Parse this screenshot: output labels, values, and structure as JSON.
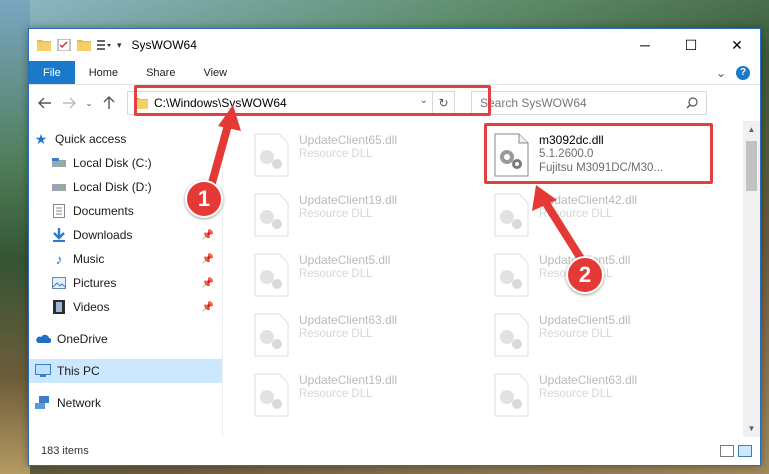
{
  "window": {
    "title": "SysWOW64",
    "controls": {
      "minimize": "─",
      "maximize": "☐",
      "close": "✕"
    }
  },
  "ribbon": {
    "tabs": [
      "File",
      "Home",
      "Share",
      "View"
    ],
    "expand": "⌄",
    "help": "?"
  },
  "address_bar": {
    "path": "C:\\Windows\\SysWOW64",
    "refresh": "↻",
    "dropdown": "⌄"
  },
  "search": {
    "placeholder": "Search SysWOW64"
  },
  "nav_pane": {
    "quick_access": "Quick access",
    "items": [
      {
        "label": "Local Disk (C:)",
        "icon": "drive-icon",
        "pinned": false
      },
      {
        "label": "Local Disk (D:)",
        "icon": "drive-icon",
        "pinned": false
      },
      {
        "label": "Documents",
        "icon": "documents-icon",
        "pinned": false
      },
      {
        "label": "Downloads",
        "icon": "downloads-icon",
        "pinned": true
      },
      {
        "label": "Music",
        "icon": "music-icon",
        "pinned": true
      },
      {
        "label": "Pictures",
        "icon": "pictures-icon",
        "pinned": true
      },
      {
        "label": "Videos",
        "icon": "videos-icon",
        "pinned": true
      }
    ],
    "onedrive": "OneDrive",
    "this_pc": "This PC",
    "network": "Network"
  },
  "files": {
    "left_column": [
      {
        "name": "UpdateClient65.dll",
        "type": "Resource DLL"
      },
      {
        "name": "UpdateClient19.dll",
        "type": "Resource DLL"
      },
      {
        "name": "UpdateClient5.dll",
        "type": "Resource DLL"
      },
      {
        "name": "UpdateClient63.dll",
        "type": "Resource DLL"
      },
      {
        "name": "UpdateClient19.dll",
        "type": "Resource DLL"
      }
    ],
    "right_column": [
      {
        "name": "m3092dc.dll",
        "version": "5.1.2600.0",
        "desc": "Fujitsu M3091DC/M30..."
      },
      {
        "name": "UpdateClient42.dll",
        "type": "Resource DLL"
      },
      {
        "name": "UpdateClient5.dll",
        "type": "Resource DLL"
      },
      {
        "name": "UpdateClient5.dll",
        "type": "Resource DLL"
      },
      {
        "name": "UpdateClient63.dll",
        "type": "Resource DLL"
      }
    ]
  },
  "status_bar": {
    "items_count": "183 items"
  },
  "annotations": {
    "step1": "1",
    "step2": "2",
    "color": "#e04040"
  }
}
